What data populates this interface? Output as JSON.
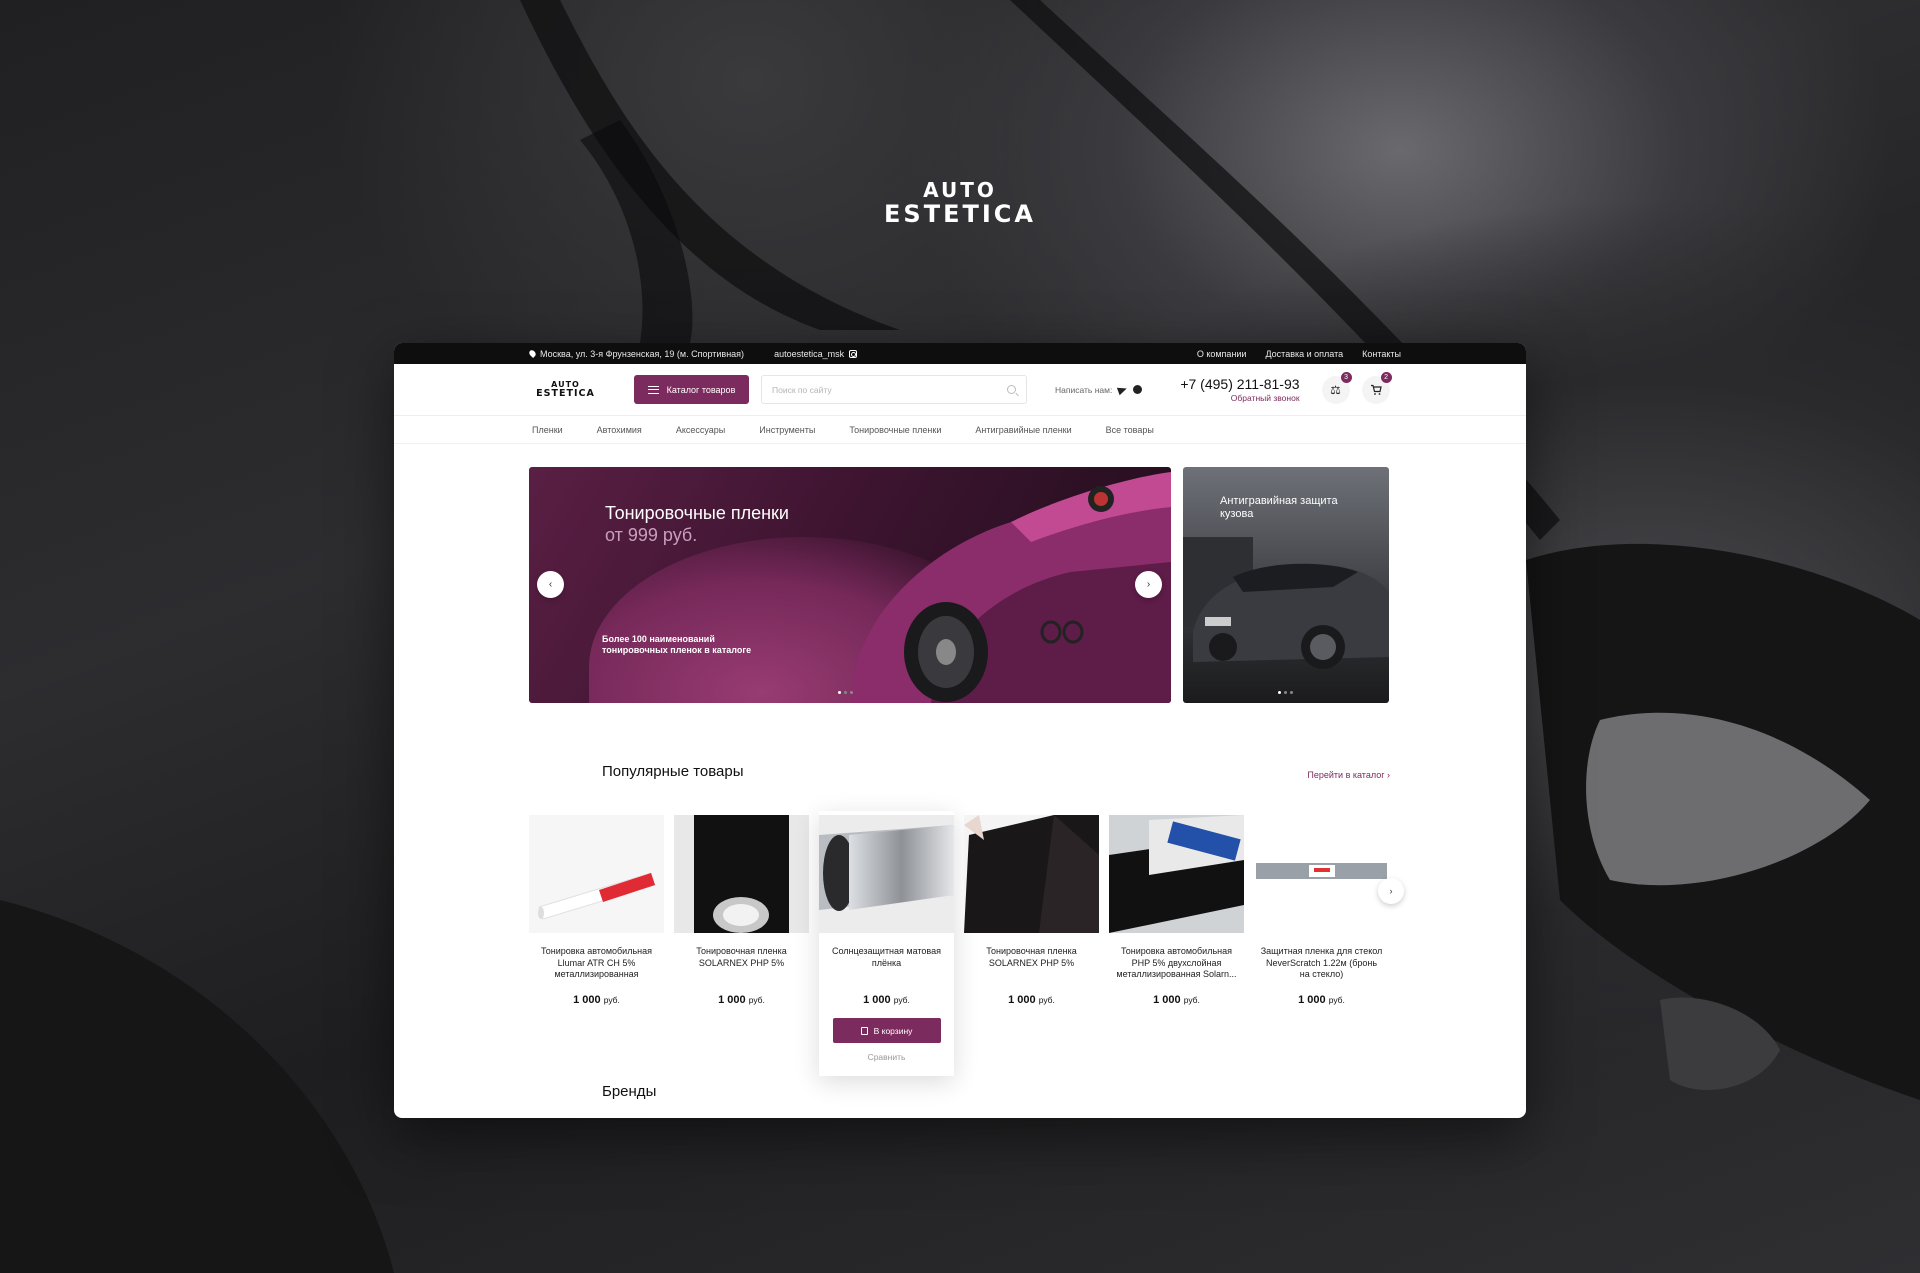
{
  "brand": {
    "line1": "AUTO",
    "line2": "ESTETICA"
  },
  "topbar": {
    "address": "Москва, ул. 3-я Фрунзенская, 19 (м. Спортивная)",
    "instagram": "autoestetica_msk",
    "links": [
      "О компании",
      "Доставка и оплата",
      "Контакты"
    ]
  },
  "header": {
    "catalog_label": "Каталог товаров",
    "search_placeholder": "Поиск по сайту",
    "write_us": "Написать нам:",
    "phone": "+7 (495) 211-81-93",
    "callback": "Обратный звонок",
    "compare_count": "3",
    "cart_count": "2",
    "icons": [
      "scales-icon",
      "cart-icon",
      "telegram-icon",
      "whatsapp-icon",
      "search-icon",
      "menu-icon",
      "location-icon",
      "instagram-icon"
    ]
  },
  "nav": [
    "Пленки",
    "Автохимия",
    "Аксессуары",
    "Инструменты",
    "Тонировочные пленки",
    "Антигравийные пленки",
    "Все товары"
  ],
  "hero": {
    "title": "Тонировочные пленки",
    "price": "от 999 руб.",
    "subtitle": "Более 100 наименований тонировочных пленок в каталоге"
  },
  "side_banner": {
    "title": "Антигравийная защита кузова"
  },
  "popular": {
    "title": "Популярные товары",
    "to_catalog": "Перейти в каталог",
    "products": [
      {
        "name": "Тонировка автомобильная Llumar ATR CH 5% металлизированная",
        "price": "1 000",
        "currency": "руб."
      },
      {
        "name": "Тонировочная пленка SOLARNEX PHP 5%",
        "price": "1 000",
        "currency": "руб."
      },
      {
        "name": "Солнцезащитная матовая плёнка",
        "price": "1 000",
        "currency": "руб.",
        "cart_label": "В корзину",
        "compare_label": "Сравнить"
      },
      {
        "name": "Тонировочная пленка SOLARNEX PHP 5%",
        "price": "1 000",
        "currency": "руб."
      },
      {
        "name": "Тонировка автомобильная PHP 5% двухслойная металлизированная Solarn...",
        "price": "1 000",
        "currency": "руб."
      },
      {
        "name": "Защитная пленка для стекол NeverScratch 1.22м (бронь на стекло)",
        "price": "1 000",
        "currency": "руб."
      }
    ]
  },
  "brands_title": "Бренды",
  "colors": {
    "accent": "#7c2b5e",
    "topbar": "#0e0e0e"
  }
}
